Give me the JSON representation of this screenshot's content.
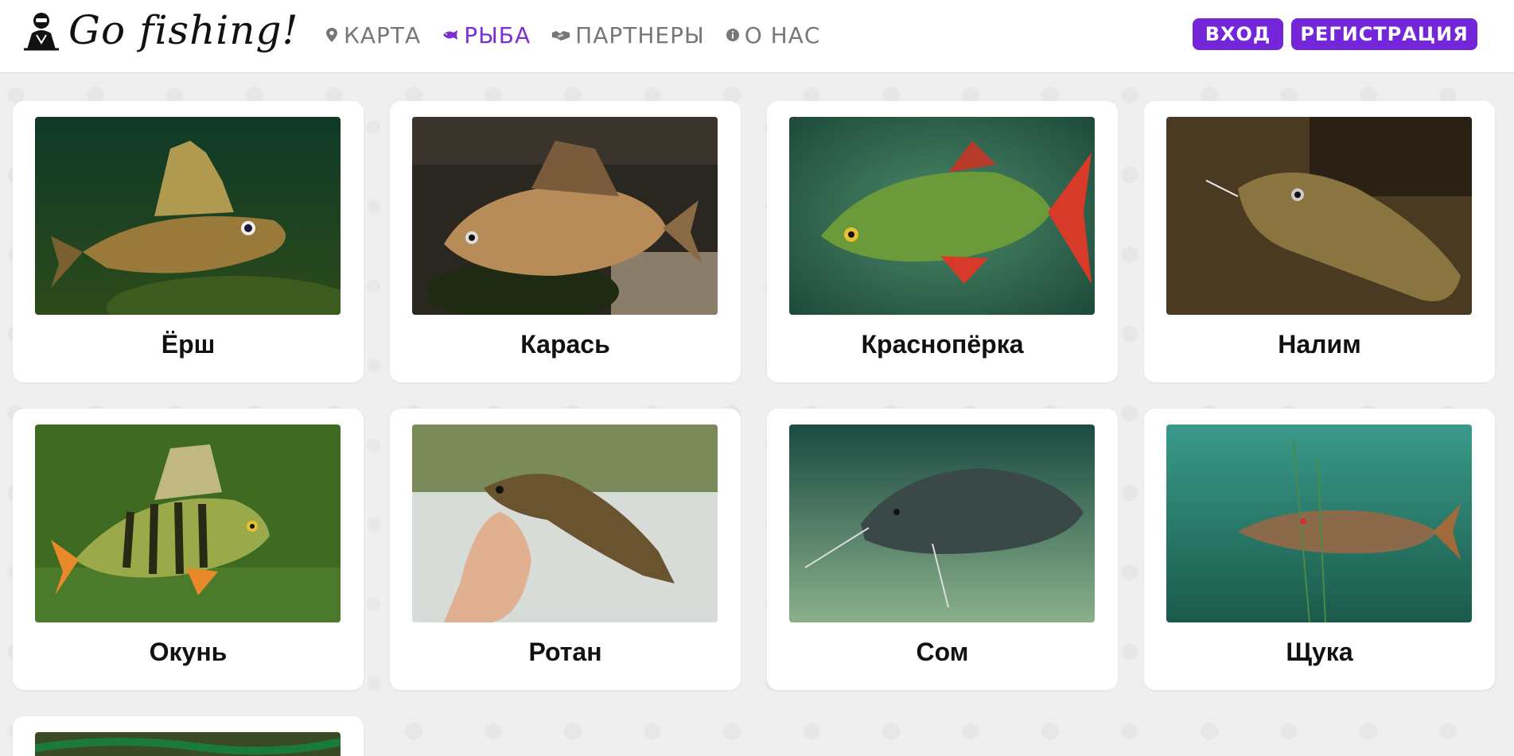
{
  "header": {
    "brand": "Go fishing!",
    "nav": [
      {
        "label": "КАРТА",
        "icon": "map-pin-icon",
        "active": false
      },
      {
        "label": "РЫБА",
        "icon": "fish-icon",
        "active": true
      },
      {
        "label": "ПАРТНЕРЫ",
        "icon": "handshake-icon",
        "active": false
      },
      {
        "label": "О НАС",
        "icon": "info-icon",
        "active": false
      }
    ],
    "login_label": "ВХОД",
    "register_label": "РЕГИСТРАЦИЯ"
  },
  "colors": {
    "accent": "#7426d9",
    "nav_active": "#7b2fd4",
    "nav_inactive": "#777777",
    "page_bg": "#efefef"
  },
  "fish": [
    {
      "name": "Ёрш"
    },
    {
      "name": "Карась"
    },
    {
      "name": "Краснопёрка"
    },
    {
      "name": "Налим"
    },
    {
      "name": "Окунь"
    },
    {
      "name": "Ротан"
    },
    {
      "name": "Сом"
    },
    {
      "name": "Щука"
    }
  ]
}
